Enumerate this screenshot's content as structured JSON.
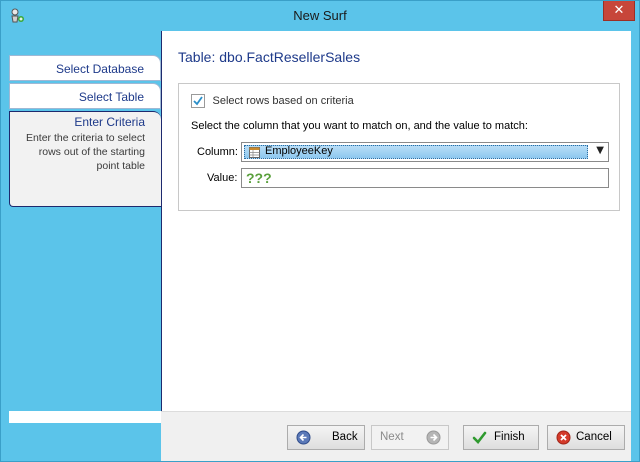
{
  "window": {
    "title": "New Surf",
    "close_label": "✕"
  },
  "sidebar": {
    "items": [
      {
        "label": "Select Database"
      },
      {
        "label": "Select Table"
      },
      {
        "label": "Enter Criteria",
        "description": "Enter the criteria to select rows out of the starting point table"
      }
    ]
  },
  "main": {
    "table_title": "Table: dbo.FactResellerSales",
    "criteria_checkbox_label": "Select rows based on criteria",
    "criteria_checked": true,
    "instructions": "Select the column that you want to match on, and the value to match:",
    "column_label": "Column:",
    "column_value": "EmployeeKey",
    "value_label": "Value:",
    "value_text": "???"
  },
  "footer": {
    "back_label": "Back",
    "next_label": "Next",
    "finish_label": "Finish",
    "cancel_label": "Cancel"
  },
  "colors": {
    "accent": "#5bc4ea",
    "nav_text": "#1e3a8a",
    "value_text": "#5aa03c"
  }
}
